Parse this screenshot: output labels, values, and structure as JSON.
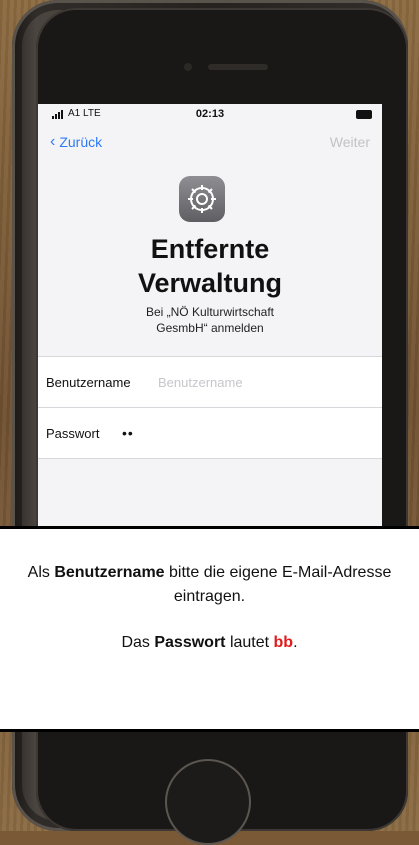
{
  "status_bar": {
    "carrier": "A1 LTE",
    "time": "02:13"
  },
  "nav": {
    "back_label": "Zurück",
    "next_label": "Weiter"
  },
  "icons": {
    "app": "settings-gear-icon",
    "back": "chevron-left-icon"
  },
  "header": {
    "title_line1": "Entfernte",
    "title_line2": "Verwaltung",
    "subtitle_line1": "Bei „NÖ Kulturwirtschaft",
    "subtitle_line2": "GesmbH“ anmelden"
  },
  "form": {
    "username_label": "Benutzername",
    "username_placeholder": "Benutzername",
    "username_value": "",
    "password_label": "Passwort",
    "password_value": "••"
  },
  "caption": {
    "line1_pre": "Als ",
    "line1_bold": "Benutzername",
    "line1_post": " bitte die eigene E-Mail-Adresse eintragen.",
    "line2_pre": "Das ",
    "line2_bold": "Passwort",
    "line2_mid": " lautet ",
    "line2_red": "bb",
    "line2_post": "."
  },
  "colors": {
    "accent": "#2f7bf5",
    "highlight": "#e11b1b"
  }
}
